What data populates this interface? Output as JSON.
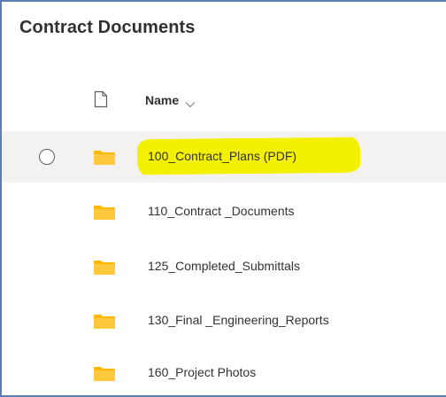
{
  "library": {
    "title": "Contract Documents"
  },
  "columns": {
    "name_header": "Name",
    "file_type_icon": "document-icon",
    "sort_icon": "chevron-down-icon"
  },
  "colors": {
    "folder": "#ffb900",
    "highlight": "#f4f100",
    "selected_row": "#f3f2f1",
    "frame_border": "#5b7fb0"
  },
  "items": [
    {
      "name": "100_Contract_Plans (PDF)",
      "type": "folder",
      "selected": true,
      "highlighted": true
    },
    {
      "name": "110_Contract _Documents",
      "type": "folder",
      "selected": false,
      "highlighted": false
    },
    {
      "name": "125_Completed_Submittals",
      "type": "folder",
      "selected": false,
      "highlighted": false
    },
    {
      "name": "130_Final _Engineering_Reports",
      "type": "folder",
      "selected": false,
      "highlighted": false
    },
    {
      "name": "160_Project Photos",
      "type": "folder",
      "selected": false,
      "highlighted": false
    }
  ]
}
